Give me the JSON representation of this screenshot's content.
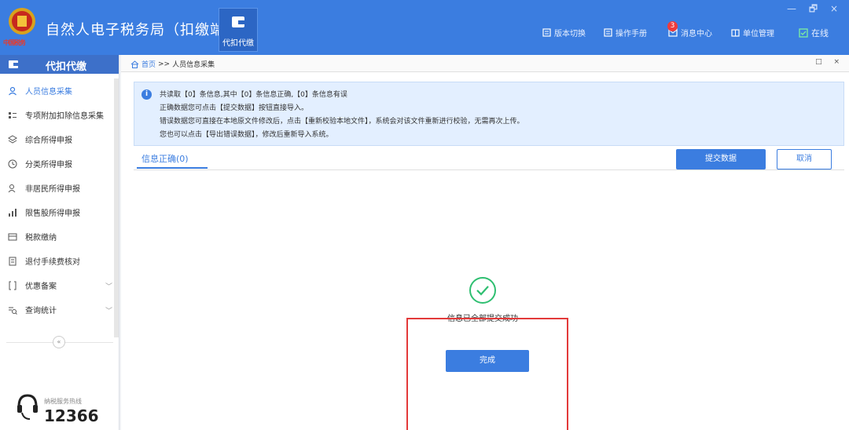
{
  "header": {
    "app_title": "自然人电子税务局（扣缴端）",
    "logo_subtitle": "中国税务",
    "module_label": "代扣代缴",
    "nav": [
      {
        "label": "版本切换",
        "icon": "version-icon"
      },
      {
        "label": "操作手册",
        "icon": "manual-icon"
      },
      {
        "label": "消息中心",
        "icon": "message-icon",
        "badge": "3"
      },
      {
        "label": "单位管理",
        "icon": "company-icon"
      },
      {
        "label": "在线",
        "icon": "online-icon"
      }
    ],
    "window_controls": "— 🗗 ×"
  },
  "sidebar": {
    "title": "代扣代缴",
    "items": [
      {
        "label": "人员信息采集",
        "icon": "person-icon",
        "active": true
      },
      {
        "label": "专项附加扣除信息采集",
        "icon": "list-icon"
      },
      {
        "label": "综合所得申报",
        "icon": "layers-icon"
      },
      {
        "label": "分类所得申报",
        "icon": "clock-icon"
      },
      {
        "label": "非居民所得申报",
        "icon": "user-outline-icon"
      },
      {
        "label": "限售股所得申报",
        "icon": "bar-chart-icon"
      },
      {
        "label": "税款缴纳",
        "icon": "wallet-icon"
      },
      {
        "label": "退付手续费核对",
        "icon": "document-icon"
      },
      {
        "label": "优惠备案",
        "icon": "bracket-icon",
        "expandable": true
      },
      {
        "label": "查询统计",
        "icon": "query-icon",
        "expandable": true
      }
    ],
    "collapse_glyph": "«",
    "hotline_label": "纳税服务热线",
    "hotline_number": "12366"
  },
  "breadcrumb": {
    "home": "首页",
    "separator": ">>",
    "current": "人员信息采集",
    "controls": "□ ×"
  },
  "info": {
    "line1": "共读取【0】条信息,其中【0】条信息正确,【0】条信息有误",
    "line2": "正确数据您可点击【提交数据】按钮直接导入。",
    "line3": "错误数据您可直接在本地原文件修改后，点击【重新校验本地文件】，系统会对该文件重新进行校验，无需再次上传。",
    "line4": "您也可以点击【导出错误数据】，修改后重新导入系统。"
  },
  "tab_label": "信息正确(0)",
  "buttons": {
    "submit": "提交数据",
    "cancel": "取消",
    "done": "完成"
  },
  "success_message": "信息已全部提交成功",
  "colors": {
    "primary": "#3b7de0",
    "header": "#3b7de0",
    "highlight_frame": "#e33a3a",
    "success": "#2fbf71"
  }
}
